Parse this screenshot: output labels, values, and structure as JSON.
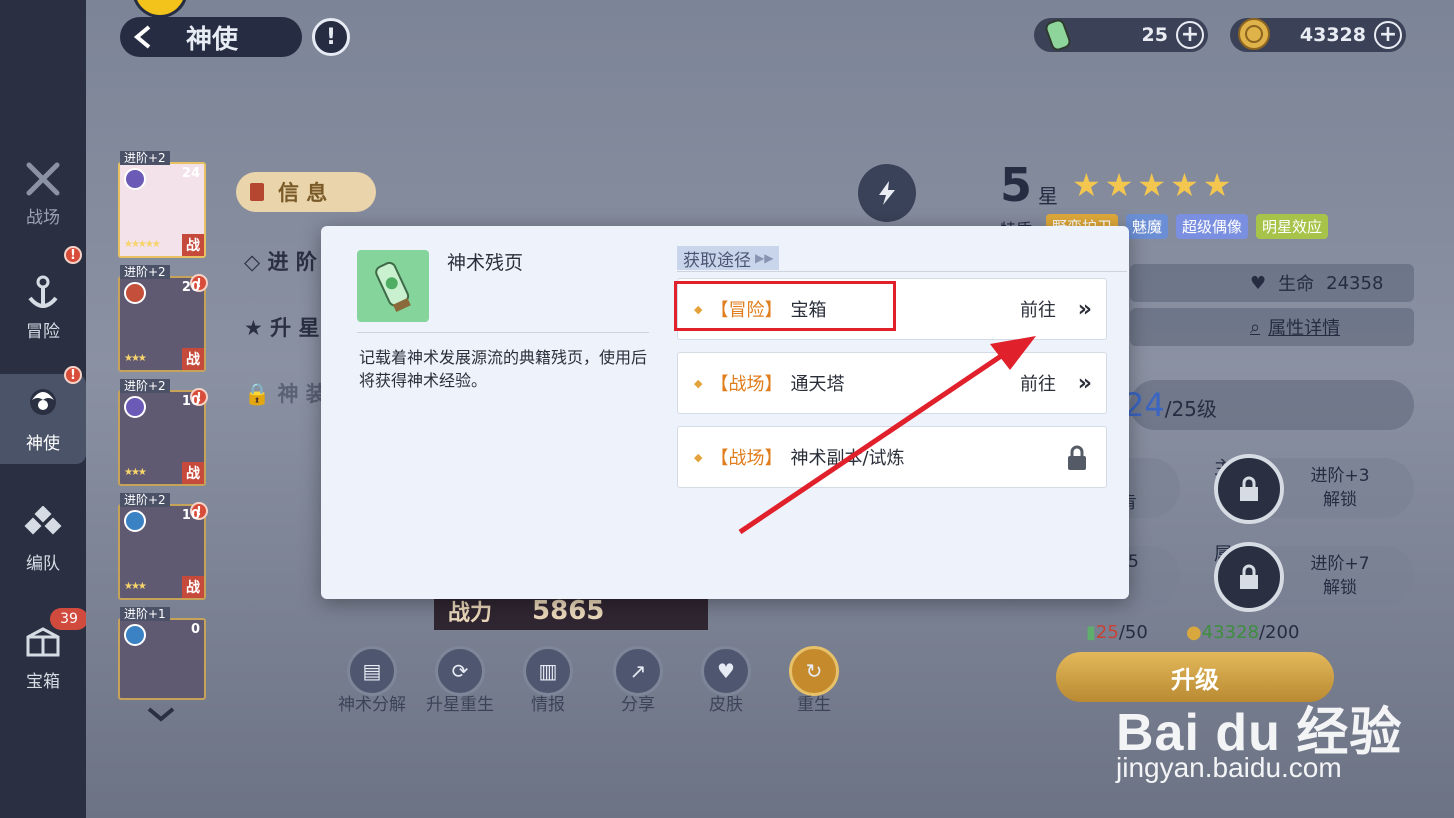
{
  "header": {
    "back_label": "神使",
    "info_icon": "exclamation-icon",
    "currencies": [
      {
        "icon": "green-bottle-icon",
        "amount": "25"
      },
      {
        "icon": "gold-coin-icon",
        "amount": "43328"
      }
    ]
  },
  "leftnav": {
    "items": [
      {
        "label": "战场",
        "icon": "crossed-swords-icon",
        "active": false
      },
      {
        "label": "冒险",
        "icon": "anchor-icon",
        "active": false,
        "badge": "!"
      },
      {
        "label": "神使",
        "icon": "avatar-icon",
        "active": true,
        "badge": "!"
      },
      {
        "label": "编队",
        "icon": "formation-icon",
        "active": false
      },
      {
        "label": "宝箱",
        "icon": "chest-icon",
        "active": false,
        "count": "39"
      }
    ]
  },
  "heroes": [
    {
      "tag": "进阶+2",
      "level": "24",
      "battle": "战"
    },
    {
      "tag": "进阶+2",
      "level": "20",
      "battle": "战"
    },
    {
      "tag": "进阶+2",
      "level": "10",
      "battle": "战"
    },
    {
      "tag": "进阶+2",
      "level": "10",
      "battle": "战"
    },
    {
      "tag": "进阶+1",
      "level": "0"
    }
  ],
  "side_tabs": {
    "info": "信 息",
    "advance": "进 阶",
    "star_up": "升 星",
    "divine": "神 装"
  },
  "right_panel": {
    "star_count": "5",
    "star_label": "星",
    "stars": "★★★★★",
    "trait_label": "特质",
    "traits": [
      "野蛮护卫",
      "魅魔",
      "超级偶像",
      "明星效应"
    ],
    "hp_label": "生命",
    "hp_value": "24358",
    "detail_link": "属性详情",
    "level_current": "24",
    "level_max": "/25级",
    "slot_main_tag": "主",
    "slot_main_label_1": "进阶+3",
    "slot_main_label_2": "解锁",
    "slot_attr_tag": "属",
    "slot_attr_label_1": "进阶+7",
    "slot_attr_label_2": "解锁",
    "partial_text_1": "肯",
    "partial_text_2": "5",
    "cost_bottle_have": "25",
    "cost_bottle_need": "/50",
    "cost_gold_have": "43328",
    "cost_gold_need": "/200",
    "upgrade_label": "升级"
  },
  "power": {
    "label": "战力",
    "value": "5865"
  },
  "actions": [
    {
      "label": "神术分解",
      "icon": "scroll-icon"
    },
    {
      "label": "升星重生",
      "icon": "refresh-icon"
    },
    {
      "label": "情报",
      "icon": "document-icon"
    },
    {
      "label": "分享",
      "icon": "share-icon"
    },
    {
      "label": "皮肤",
      "icon": "heart-icon"
    },
    {
      "label": "重生",
      "icon": "rebirth-icon"
    }
  ],
  "dialog": {
    "item_name": "神术残页",
    "item_desc": "记载着神术发展源流的典籍残页，使用后将获得神术经验。",
    "source_title": "获取途径",
    "sources": [
      {
        "category": "【冒险】",
        "name": "宝箱",
        "action": "前往",
        "locked": false
      },
      {
        "category": "【战场】",
        "name": "通天塔",
        "action": "前往",
        "locked": false
      },
      {
        "category": "【战场】",
        "name": "神术副本/试炼",
        "action": "",
        "locked": true
      }
    ]
  },
  "watermark": {
    "brand": "Bai du 经验",
    "url": "jingyan.baidu.com"
  },
  "colors": {
    "nav_bg": "#2a3042",
    "dialog_bg": "#edf2fb",
    "highlight": "#e0202a",
    "category_orange": "#e07d1d",
    "level_blue": "#3a65c2"
  }
}
